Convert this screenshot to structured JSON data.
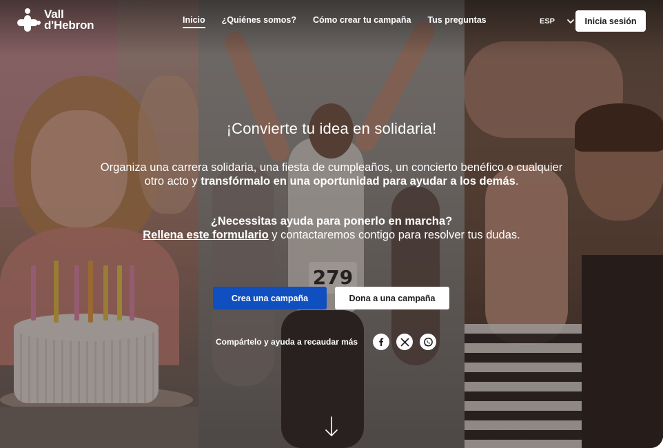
{
  "brand": {
    "logo_line1": "Vall",
    "logo_line2": "d'Hebron"
  },
  "nav": {
    "items": [
      {
        "label": "Inicio",
        "active": true
      },
      {
        "label": "¿Quiénes somos?",
        "active": false
      },
      {
        "label": "Cómo crear tu campaña",
        "active": false
      },
      {
        "label": "Tus preguntas",
        "active": false
      }
    ]
  },
  "language": {
    "selected": "ESP"
  },
  "header": {
    "login_label": "Inicia sesión"
  },
  "hero": {
    "title": "¡Convierte tu idea en solidaria!",
    "desc_plain": "Organiza una carrera solidaria, una fiesta de cumpleaños, un concierto benéfico o cualquier otro acto y ",
    "desc_bold": "transfórmalo en una oportunidad para ayudar a los demás",
    "desc_end": ".",
    "help_question": "¿Necessitas ayuda para ponerlo en marcha?",
    "help_link": "Rellena este formulario",
    "help_rest": " y contactaremos contigo para resolver tus dudas.",
    "primary_cta": "Crea una campaña",
    "secondary_cta": "Dona a una campaña",
    "share_label": "Compártelo y ayuda a recaudar más",
    "share_icons": [
      "facebook-icon",
      "x-icon",
      "whatsapp-icon"
    ],
    "bib_number": "279"
  },
  "colors": {
    "primary": "#0f4fbf",
    "white": "#ffffff",
    "text_dark": "#1b1b1b"
  }
}
